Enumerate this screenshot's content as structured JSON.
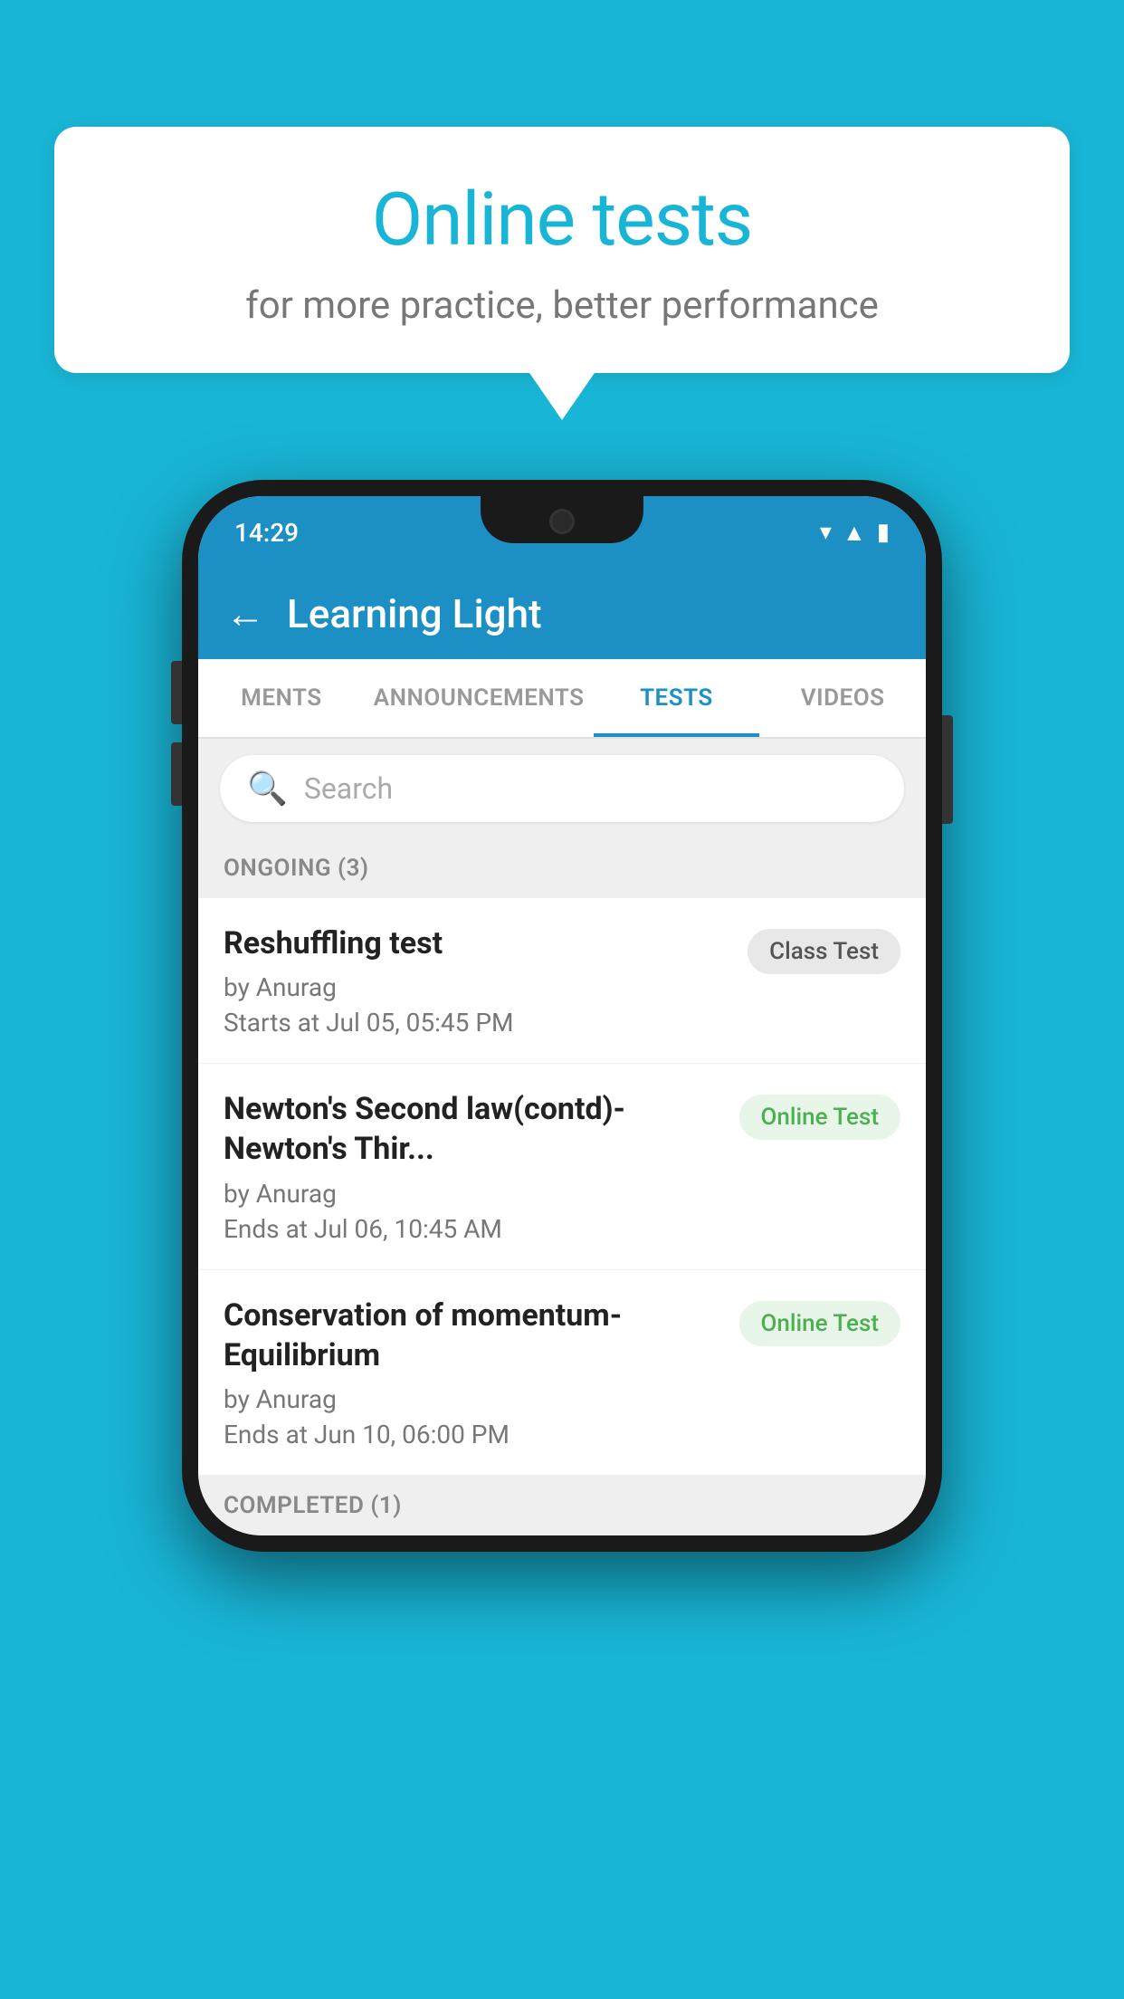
{
  "background_color": "#19b5d6",
  "speech_bubble": {
    "title": "Online tests",
    "subtitle": "for more practice, better performance"
  },
  "phone": {
    "status_bar": {
      "time": "14:29",
      "icons": [
        "wifi",
        "signal",
        "battery"
      ]
    },
    "app_bar": {
      "title": "Learning Light",
      "back_label": "←"
    },
    "tabs": [
      {
        "label": "MENTS",
        "active": false
      },
      {
        "label": "ANNOUNCEMENTS",
        "active": false
      },
      {
        "label": "TESTS",
        "active": true
      },
      {
        "label": "VIDEOS",
        "active": false
      }
    ],
    "search": {
      "placeholder": "Search"
    },
    "ongoing_section": {
      "header": "ONGOING (3)",
      "items": [
        {
          "title": "Reshuffling test",
          "author": "by Anurag",
          "date": "Starts at  Jul 05, 05:45 PM",
          "badge": "Class Test",
          "badge_type": "class"
        },
        {
          "title": "Newton's Second law(contd)-Newton's Thir...",
          "author": "by Anurag",
          "date": "Ends at  Jul 06, 10:45 AM",
          "badge": "Online Test",
          "badge_type": "online"
        },
        {
          "title": "Conservation of momentum-Equilibrium",
          "author": "by Anurag",
          "date": "Ends at  Jun 10, 06:00 PM",
          "badge": "Online Test",
          "badge_type": "online"
        }
      ]
    },
    "completed_section": {
      "header": "COMPLETED (1)"
    }
  }
}
